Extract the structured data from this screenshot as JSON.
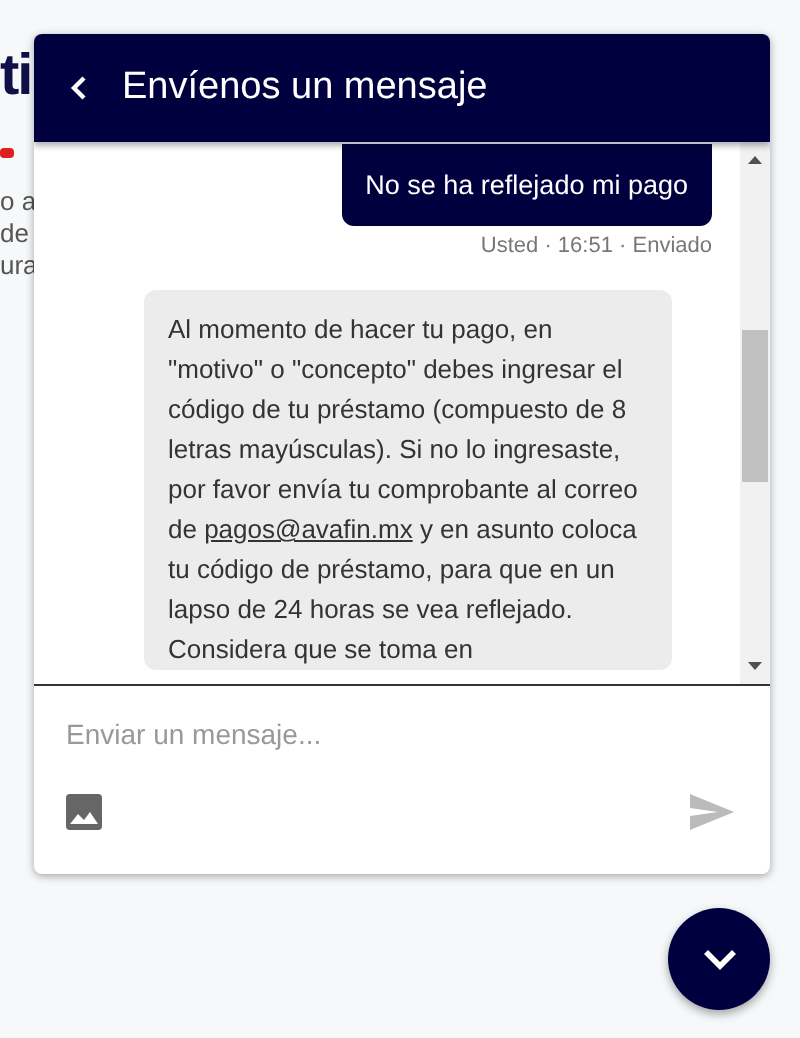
{
  "background_page": {
    "heading": "ti",
    "lines": [
      "o a",
      "de",
      "ura"
    ]
  },
  "chat": {
    "title": "Envíenos un mensaje",
    "messages": [
      {
        "kind": "sent",
        "text": "No se ha reflejado mi pago",
        "meta": "Usted · 16:51 · Enviado"
      },
      {
        "kind": "received",
        "text_before": "Al momento de hacer tu pago, en \"motivo\" o \"concepto\" debes ingresar el código de tu préstamo (compuesto de 8 letras mayúsculas). Si no lo ingresaste, por favor envía tu comprobante al correo de ",
        "link": "pagos@avafin.mx",
        "text_after": " y en asunto coloca tu código de préstamo, para que en un lapso de 24 horas se vea reflejado. Considera que se toma en"
      }
    ],
    "input": {
      "placeholder": "Enviar un mensaje..."
    }
  }
}
